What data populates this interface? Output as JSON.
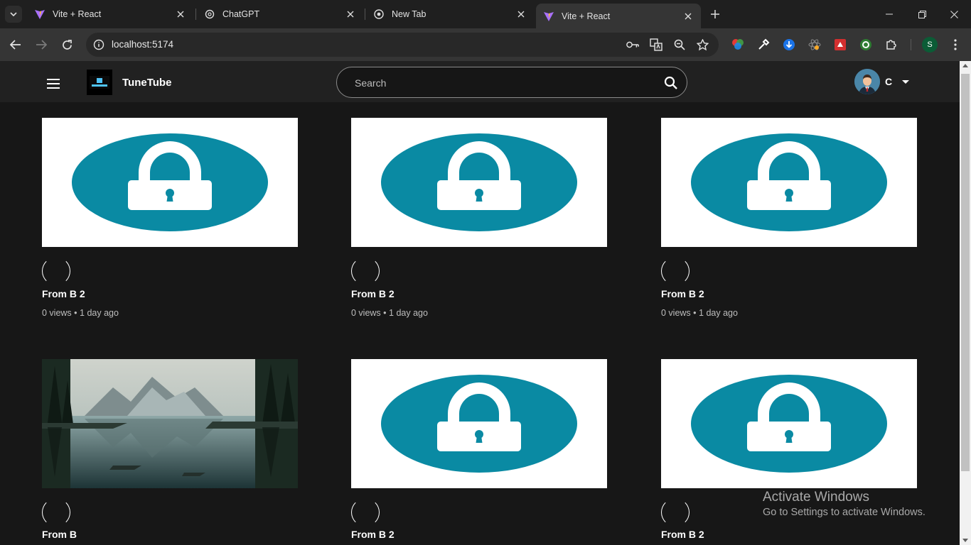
{
  "browser": {
    "tabs": [
      {
        "title": "Vite + React",
        "icon": "vite-icon"
      },
      {
        "title": "ChatGPT",
        "icon": "chatgpt-icon"
      },
      {
        "title": "New Tab",
        "icon": "chrome-icon"
      },
      {
        "title": "Vite + React",
        "icon": "vite-icon",
        "active": true
      }
    ],
    "url": "localhost:5174",
    "profile_initial": "S"
  },
  "app": {
    "brand": "TuneTube",
    "search_placeholder": "Search",
    "user_initial": "C"
  },
  "videos": [
    {
      "title": "From B 2",
      "views": "0 views",
      "time": "1 day ago",
      "thumbnail": "lock-icon"
    },
    {
      "title": "From B 2",
      "views": "0 views",
      "time": "1 day ago",
      "thumbnail": "lock-icon"
    },
    {
      "title": "From B 2",
      "views": "0 views",
      "time": "1 day ago",
      "thumbnail": "lock-icon"
    },
    {
      "title": "From B",
      "thumbnail": "lake-landscape"
    },
    {
      "title": "From B 2",
      "thumbnail": "lock-icon"
    },
    {
      "title": "From B 2",
      "thumbnail": "lock-icon"
    }
  ],
  "watermark": {
    "line1": "Activate Windows",
    "line2": "Go to Settings to activate Windows."
  },
  "colors": {
    "lock_teal": "#0a8aa3",
    "page_bg": "#171717",
    "appbar_bg": "#212121"
  }
}
